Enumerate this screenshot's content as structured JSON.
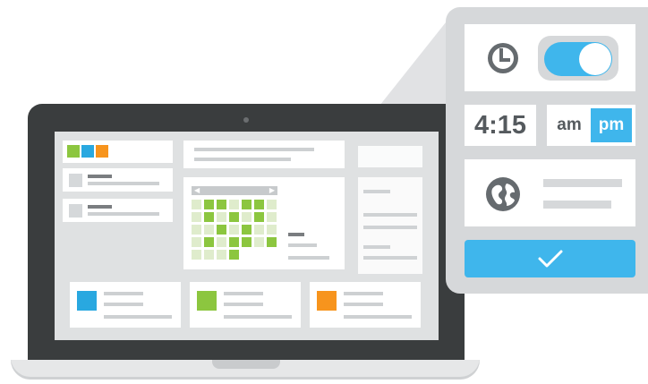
{
  "popover": {
    "time_value": "4:15",
    "am_label": "am",
    "pm_label": "pm",
    "toggle_on": true
  },
  "colors": {
    "accent_blue": "#3fb6ec",
    "green": "#8cc63f",
    "orange": "#f7941d",
    "blue": "#29a8e0"
  },
  "icons": {
    "clock": "clock-icon",
    "globe": "globe-icon",
    "check": "checkmark-icon",
    "arrow_left": "arrow-left-icon",
    "arrow_right": "arrow-right-icon"
  }
}
